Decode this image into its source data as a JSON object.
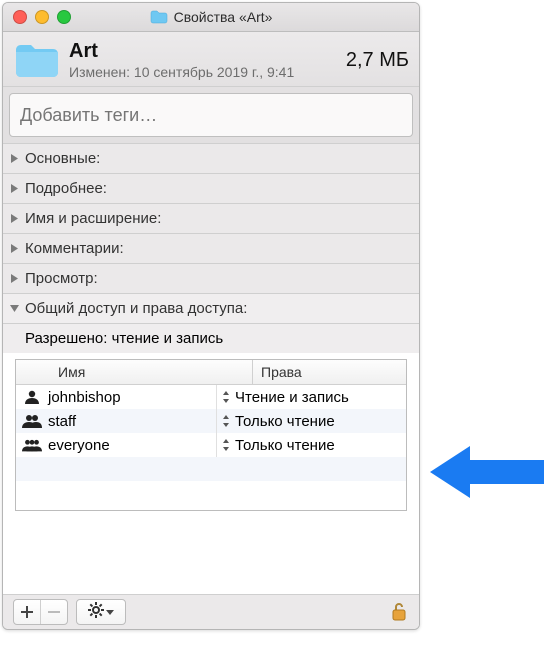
{
  "titlebar": {
    "title": "Свойства «Art»"
  },
  "header": {
    "name": "Art",
    "size": "2,7 МБ",
    "modified": "Изменен: 10 сентябрь 2019 г., 9:41"
  },
  "tags": {
    "placeholder": "Добавить теги…"
  },
  "sections": {
    "general": "Основные:",
    "more": "Подробнее:",
    "nameext": "Имя и расширение:",
    "comments": "Комментарии:",
    "preview": "Просмотр:",
    "sharing": "Общий доступ и права доступа:"
  },
  "sharing": {
    "allowed_label": "Разрешено: чтение и запись",
    "col_name": "Имя",
    "col_priv": "Права",
    "rows": [
      {
        "name": "johnbishop",
        "priv": "Чтение и запись",
        "icon": "single"
      },
      {
        "name": "staff",
        "priv": "Только чтение",
        "icon": "pair"
      },
      {
        "name": "everyone",
        "priv": "Только чтение",
        "icon": "group"
      }
    ]
  },
  "colors": {
    "arrow": "#1a7bf2"
  }
}
